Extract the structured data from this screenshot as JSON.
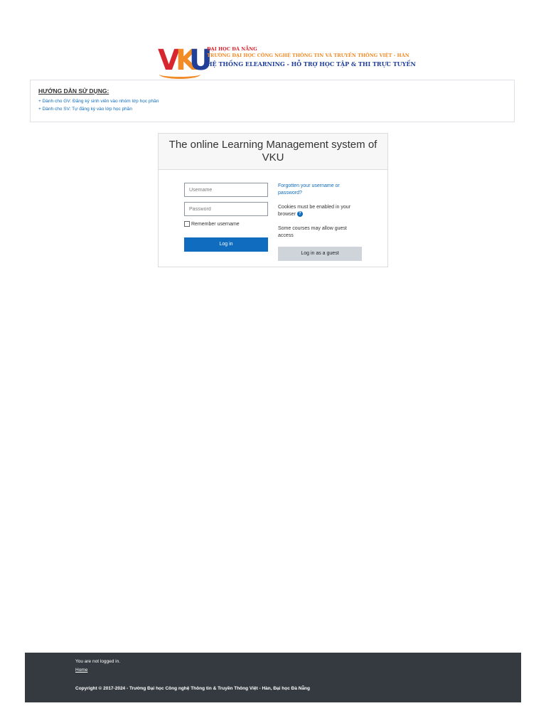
{
  "logo": {
    "mark": "VKU",
    "line1": "ĐẠI HỌC ĐÀ NẴNG",
    "line2": "TRƯỜNG ĐẠI HỌC CÔNG NGHỆ THÔNG TIN VÀ TRUYỀN THÔNG VIỆT - HÀN",
    "line3": "HỆ THỐNG ELEARNING - HỖ TRỢ HỌC TẬP & THI TRỰC TUYẾN",
    "colors": {
      "red": "#d8262e",
      "orange": "#f28c28",
      "blue": "#1f3f99"
    }
  },
  "guide": {
    "title": "HƯỚNG DẪN SỬ DỤNG:",
    "links": [
      "+ Dành cho GV: Đăng ký sinh viên vào nhóm lớp học phần",
      "+ Dành cho SV: Tự đăng ký vào lớp học phần"
    ]
  },
  "login": {
    "header": "The online Learning Management system of VKU",
    "username_placeholder": "Username",
    "password_placeholder": "Password",
    "remember_label": "Remember username",
    "login_button": "Log in",
    "forgot_link": "Forgotten your username or password?",
    "cookies_text": "Cookies must be enabled in your browser",
    "help_icon": "?",
    "guest_text": "Some courses may allow guest access",
    "guest_button": "Log in as a guest"
  },
  "footer": {
    "not_logged_in": "You are not logged in.",
    "home_link": "Home",
    "copyright": "Copyright © 2017-2024 - Trường Đại học Công nghệ Thông tin & Truyền Thông Việt - Hàn, Đại học Đà Nẵng"
  },
  "colors": {
    "accent": "#0f6cbf",
    "footer_bg": "#343a40",
    "guest_button_bg": "#ced4da"
  }
}
